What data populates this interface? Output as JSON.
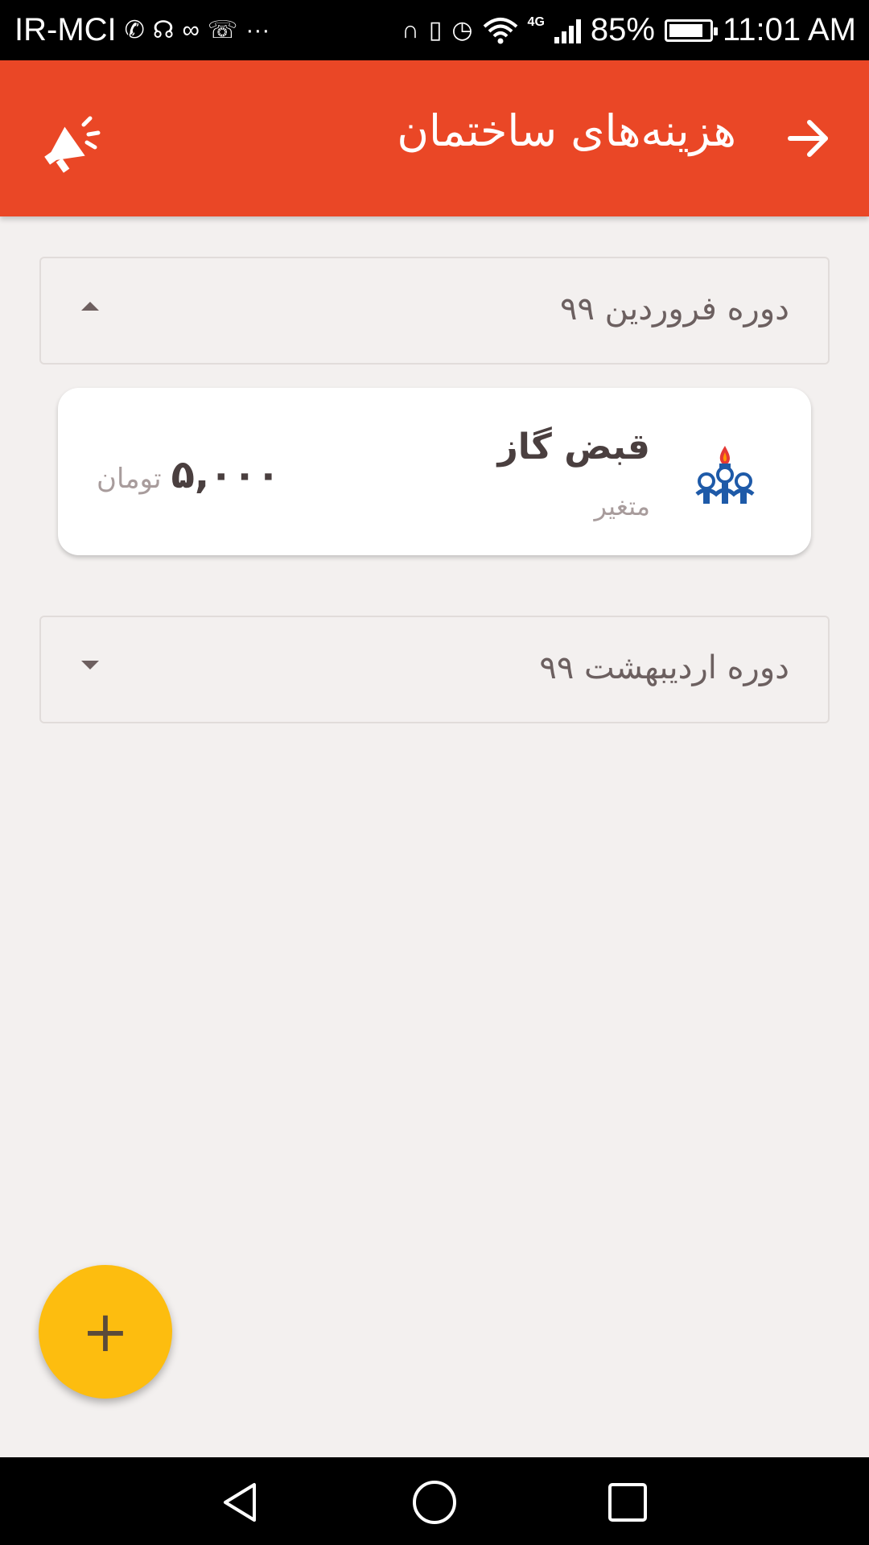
{
  "status_bar": {
    "carrier": "IR-MCI",
    "network": "4G",
    "battery_percent": "85%",
    "battery_level": 0.85,
    "time": "11:01 AM",
    "icons": [
      "whatsapp-icon",
      "headset-icon",
      "voicemail-icon",
      "missed-call-icon",
      "more-icon",
      "headphones-icon",
      "vibrate-icon",
      "alarm-icon",
      "wifi-icon",
      "signal-icon",
      "battery-icon"
    ]
  },
  "app_bar": {
    "title": "هزینه‌های ساختمان",
    "back_icon": "arrow-right-icon",
    "action_icon": "megaphone-icon",
    "color": "#ea4726"
  },
  "periods": [
    {
      "label": "دوره فروردین ۹۹",
      "expanded": true,
      "bills": [
        {
          "name": "قبض گاز",
          "type": "متغیر",
          "amount": "۵,۰۰۰",
          "currency": "تومان",
          "icon": "gas-company-logo-icon"
        }
      ]
    },
    {
      "label": "دوره اردیبهشت ۹۹",
      "expanded": false,
      "bills": []
    }
  ],
  "fab": {
    "label": "+",
    "color": "#fdbd0f"
  },
  "nav_bar": {
    "icons": [
      "back-nav-icon",
      "home-nav-icon",
      "recents-nav-icon"
    ]
  }
}
